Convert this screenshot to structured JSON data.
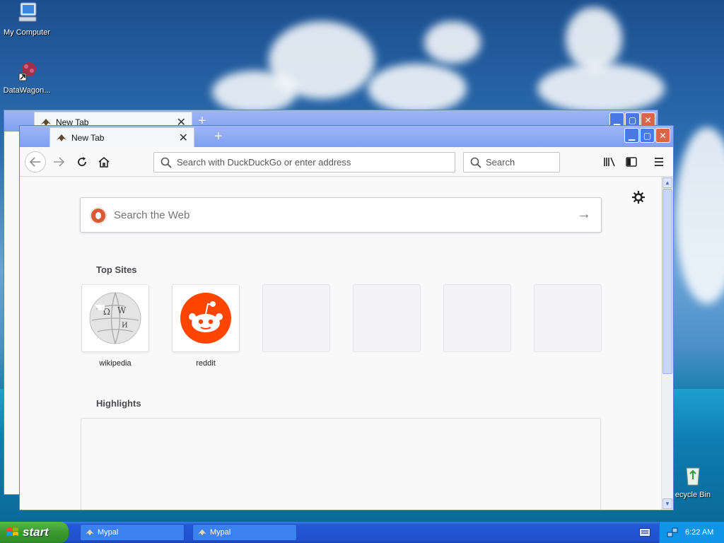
{
  "desktop": {
    "icons": [
      {
        "label": "My Computer"
      },
      {
        "label": "DataWagon..."
      },
      {
        "label": "ecycle Bin"
      }
    ]
  },
  "back_window": {
    "tab_title": "New Tab"
  },
  "browser": {
    "tab_title": "New Tab",
    "urlbar_placeholder": "Search with DuckDuckGo or enter address",
    "searchbar_placeholder": "Search",
    "websearch_placeholder": "Search the Web",
    "top_sites_title": "Top Sites",
    "top_sites": [
      {
        "label": "wikipedia"
      },
      {
        "label": "reddit"
      },
      {
        "label": ""
      },
      {
        "label": ""
      },
      {
        "label": ""
      },
      {
        "label": ""
      }
    ],
    "highlights_title": "Highlights"
  },
  "taskbar": {
    "start_label": "start",
    "tasks": [
      {
        "label": "Mypal"
      },
      {
        "label": "Mypal"
      }
    ],
    "clock": "6:22 AM"
  },
  "colors": {
    "window_frame": "#7d9cf0",
    "taskbar": "#2151cd",
    "start_button": "#3c9a30",
    "reddit": "#ff4500",
    "duckduckgo": "#de5833"
  },
  "icons": [
    "computer-icon",
    "shortcut-icon",
    "recycle-bin-icon",
    "back-arrow-icon",
    "forward-arrow-icon",
    "reload-icon",
    "home-icon",
    "search-icon",
    "library-icon",
    "sidebar-icon",
    "menu-icon",
    "gear-icon",
    "duckduckgo-icon",
    "arrow-right-icon",
    "wikipedia-icon",
    "reddit-icon",
    "windows-flag-icon",
    "keyboard-icon",
    "network-icon"
  ]
}
